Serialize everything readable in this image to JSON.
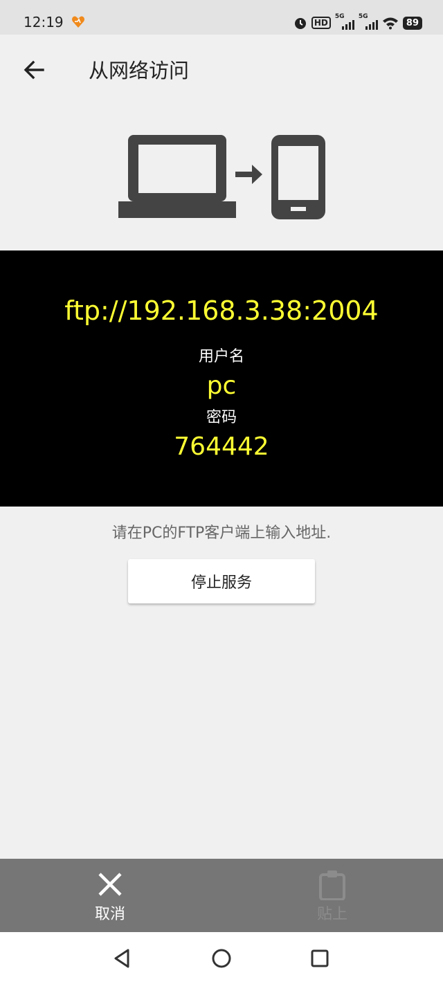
{
  "status_bar": {
    "time": "12:19",
    "hd_label": "HD",
    "signal_1_label": "5G",
    "signal_2_label": "5G",
    "battery": "89"
  },
  "header": {
    "title": "从网络访问"
  },
  "connection": {
    "url": "ftp://192.168.3.38:2004",
    "username_label": "用户名",
    "username": "pc",
    "password_label": "密码",
    "password": "764442"
  },
  "hint": "请在PC的FTP客户端上输入地址.",
  "stop_button_label": "停止服务",
  "bottom_actions": {
    "cancel_label": "取消",
    "paste_label": "贴上"
  },
  "colors": {
    "highlight": "#ffff33",
    "panel_background": "#000000",
    "bottom_bar": "#767676",
    "heart_icon": "#f08a1c"
  },
  "icons": [
    "heart-icon",
    "alarm-icon",
    "signal-icon",
    "wifi-icon",
    "battery-icon",
    "back-arrow-icon",
    "laptop-icon",
    "arrow-right-icon",
    "phone-icon",
    "close-icon",
    "clipboard-icon",
    "nav-back-icon",
    "nav-home-icon",
    "nav-recents-icon"
  ]
}
